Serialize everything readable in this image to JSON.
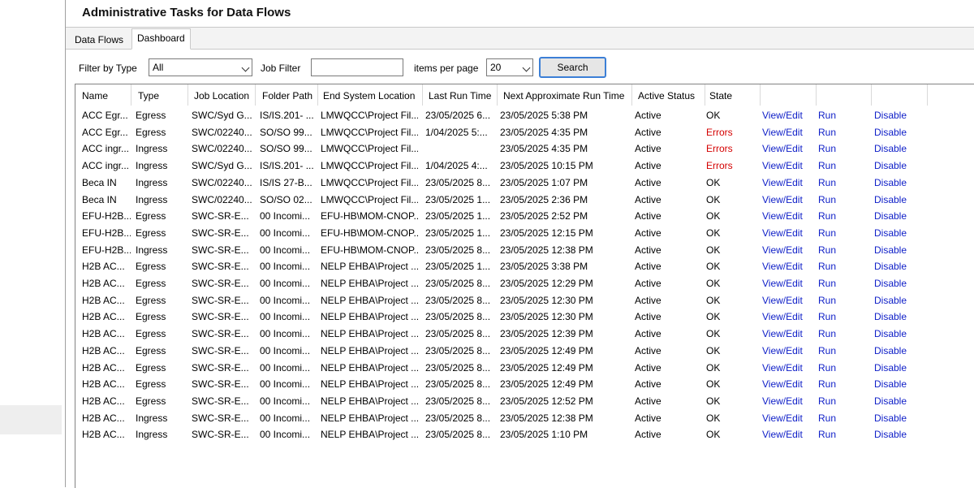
{
  "window": {
    "title": "Administrative Tasks for Data Flows"
  },
  "tabs": [
    {
      "label": "Data Flows",
      "active": false
    },
    {
      "label": "Dashboard",
      "active": true
    }
  ],
  "filters": {
    "type_label": "Filter by Type",
    "type_value": "All",
    "job_label": "Job Filter",
    "job_value": "",
    "ipp_label": "items per page",
    "ipp_value": "20",
    "search_label": "Search"
  },
  "columns": [
    "Name",
    "Type",
    "Job Location",
    "Folder Path",
    "End System Location",
    "Last Run Time",
    "Next Approximate Run Time",
    "Active Status",
    "State"
  ],
  "colors": {
    "error": "#d40000",
    "link": "#1020c8",
    "accent": "#3c7fd6"
  },
  "rows": [
    {
      "name": "ACC Egr...",
      "type": "Egress",
      "job": "SWC/Syd G...",
      "folder": "IS/IS.201- ...",
      "end": "LMWQCC\\Project Fil...",
      "last": "23/05/2025 6...",
      "next": "23/05/2025 5:38 PM",
      "active": "Active",
      "state": "OK",
      "view": "View/Edit",
      "run": "Run",
      "disable": "Disable"
    },
    {
      "name": "ACC Egr...",
      "type": "Egress",
      "job": "SWC/02240...",
      "folder": "SO/SO 99...",
      "end": "LMWQCC\\Project Fil...",
      "last": "1/04/2025 5:...",
      "next": "23/05/2025 4:35 PM",
      "active": "Active",
      "state": "Errors",
      "view": "View/Edit",
      "run": "Run",
      "disable": "Disable"
    },
    {
      "name": "ACC ingr...",
      "type": "Ingress",
      "job": "SWC/02240...",
      "folder": "SO/SO 99...",
      "end": "LMWQCC\\Project Fil...",
      "last": "",
      "next": "23/05/2025 4:35 PM",
      "active": "Active",
      "state": "Errors",
      "view": "View/Edit",
      "run": "Run",
      "disable": "Disable"
    },
    {
      "name": "ACC ingr...",
      "type": "Ingress",
      "job": "SWC/Syd G...",
      "folder": "IS/IS.201- ...",
      "end": "LMWQCC\\Project Fil...",
      "last": "1/04/2025 4:...",
      "next": "23/05/2025 10:15 PM",
      "active": "Active",
      "state": "Errors",
      "view": "View/Edit",
      "run": "Run",
      "disable": "Disable"
    },
    {
      "name": "Beca IN",
      "type": "Ingress",
      "job": "SWC/02240...",
      "folder": "IS/IS 27-B...",
      "end": "LMWQCC\\Project Fil...",
      "last": "23/05/2025 8...",
      "next": "23/05/2025 1:07 PM",
      "active": "Active",
      "state": "OK",
      "view": "View/Edit",
      "run": "Run",
      "disable": "Disable"
    },
    {
      "name": "Beca IN",
      "type": "Ingress",
      "job": "SWC/02240...",
      "folder": "SO/SO 02...",
      "end": "LMWQCC\\Project Fil...",
      "last": "23/05/2025 1...",
      "next": "23/05/2025 2:36 PM",
      "active": "Active",
      "state": "OK",
      "view": "View/Edit",
      "run": "Run",
      "disable": "Disable"
    },
    {
      "name": "EFU-H2B...",
      "type": "Egress",
      "job": "SWC-SR-E...",
      "folder": "00 Incomi...",
      "end": "EFU-HB\\MOM-CNOP...",
      "last": "23/05/2025 1...",
      "next": "23/05/2025 2:52 PM",
      "active": "Active",
      "state": "OK",
      "view": "View/Edit",
      "run": "Run",
      "disable": "Disable"
    },
    {
      "name": "EFU-H2B...",
      "type": "Egress",
      "job": "SWC-SR-E...",
      "folder": "00 Incomi...",
      "end": "EFU-HB\\MOM-CNOP...",
      "last": "23/05/2025 1...",
      "next": "23/05/2025 12:15 PM",
      "active": "Active",
      "state": "OK",
      "view": "View/Edit",
      "run": "Run",
      "disable": "Disable"
    },
    {
      "name": "EFU-H2B...",
      "type": "Ingress",
      "job": "SWC-SR-E...",
      "folder": "00 Incomi...",
      "end": "EFU-HB\\MOM-CNOP...",
      "last": "23/05/2025 8...",
      "next": "23/05/2025 12:38 PM",
      "active": "Active",
      "state": "OK",
      "view": "View/Edit",
      "run": "Run",
      "disable": "Disable"
    },
    {
      "name": "H2B AC...",
      "type": "Egress",
      "job": "SWC-SR-E...",
      "folder": "00 Incomi...",
      "end": "NELP EHBA\\Project ...",
      "last": "23/05/2025 1...",
      "next": "23/05/2025 3:38 PM",
      "active": "Active",
      "state": "OK",
      "view": "View/Edit",
      "run": "Run",
      "disable": "Disable"
    },
    {
      "name": "H2B AC...",
      "type": "Egress",
      "job": "SWC-SR-E...",
      "folder": "00 Incomi...",
      "end": "NELP EHBA\\Project ...",
      "last": "23/05/2025 8...",
      "next": "23/05/2025 12:29 PM",
      "active": "Active",
      "state": "OK",
      "view": "View/Edit",
      "run": "Run",
      "disable": "Disable"
    },
    {
      "name": "H2B AC...",
      "type": "Egress",
      "job": "SWC-SR-E...",
      "folder": "00 Incomi...",
      "end": "NELP EHBA\\Project ...",
      "last": "23/05/2025 8...",
      "next": "23/05/2025 12:30 PM",
      "active": "Active",
      "state": "OK",
      "view": "View/Edit",
      "run": "Run",
      "disable": "Disable"
    },
    {
      "name": "H2B AC...",
      "type": "Egress",
      "job": "SWC-SR-E...",
      "folder": "00 Incomi...",
      "end": "NELP EHBA\\Project ...",
      "last": "23/05/2025 8...",
      "next": "23/05/2025 12:30 PM",
      "active": "Active",
      "state": "OK",
      "view": "View/Edit",
      "run": "Run",
      "disable": "Disable"
    },
    {
      "name": "H2B AC...",
      "type": "Egress",
      "job": "SWC-SR-E...",
      "folder": "00 Incomi...",
      "end": "NELP EHBA\\Project ...",
      "last": "23/05/2025 8...",
      "next": "23/05/2025 12:39 PM",
      "active": "Active",
      "state": "OK",
      "view": "View/Edit",
      "run": "Run",
      "disable": "Disable"
    },
    {
      "name": "H2B AC...",
      "type": "Egress",
      "job": "SWC-SR-E...",
      "folder": "00 Incomi...",
      "end": "NELP EHBA\\Project ...",
      "last": "23/05/2025 8...",
      "next": "23/05/2025 12:49 PM",
      "active": "Active",
      "state": "OK",
      "view": "View/Edit",
      "run": "Run",
      "disable": "Disable"
    },
    {
      "name": "H2B AC...",
      "type": "Egress",
      "job": "SWC-SR-E...",
      "folder": "00 Incomi...",
      "end": "NELP EHBA\\Project ...",
      "last": "23/05/2025 8...",
      "next": "23/05/2025 12:49 PM",
      "active": "Active",
      "state": "OK",
      "view": "View/Edit",
      "run": "Run",
      "disable": "Disable"
    },
    {
      "name": "H2B AC...",
      "type": "Egress",
      "job": "SWC-SR-E...",
      "folder": "00 Incomi...",
      "end": "NELP EHBA\\Project ...",
      "last": "23/05/2025 8...",
      "next": "23/05/2025 12:49 PM",
      "active": "Active",
      "state": "OK",
      "view": "View/Edit",
      "run": "Run",
      "disable": "Disable"
    },
    {
      "name": "H2B AC...",
      "type": "Egress",
      "job": "SWC-SR-E...",
      "folder": "00 Incomi...",
      "end": "NELP EHBA\\Project ...",
      "last": "23/05/2025 8...",
      "next": "23/05/2025 12:52 PM",
      "active": "Active",
      "state": "OK",
      "view": "View/Edit",
      "run": "Run",
      "disable": "Disable"
    },
    {
      "name": "H2B AC...",
      "type": "Ingress",
      "job": "SWC-SR-E...",
      "folder": "00 Incomi...",
      "end": "NELP EHBA\\Project ...",
      "last": "23/05/2025 8...",
      "next": "23/05/2025 12:38 PM",
      "active": "Active",
      "state": "OK",
      "view": "View/Edit",
      "run": "Run",
      "disable": "Disable"
    },
    {
      "name": "H2B AC...",
      "type": "Ingress",
      "job": "SWC-SR-E...",
      "folder": "00 Incomi...",
      "end": "NELP EHBA\\Project ...",
      "last": "23/05/2025 8...",
      "next": "23/05/2025 1:10 PM",
      "active": "Active",
      "state": "OK",
      "view": "View/Edit",
      "run": "Run",
      "disable": "Disable"
    }
  ]
}
